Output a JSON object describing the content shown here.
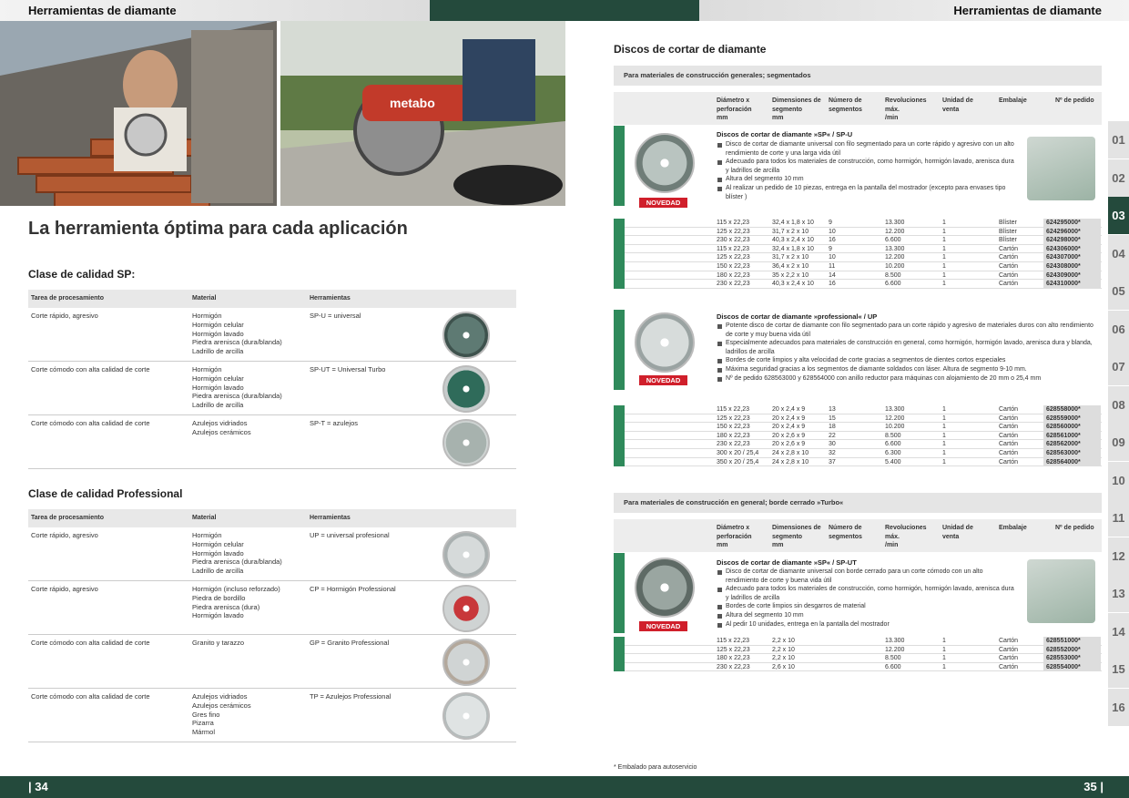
{
  "header": {
    "left_title": "Herramientas de diamante",
    "right_title": "Herramientas de diamante"
  },
  "left": {
    "headline": "La herramienta óptima para cada aplicación",
    "sp": {
      "title": "Clase de calidad SP:",
      "head": {
        "task": "Tarea de procesamiento",
        "material": "Material",
        "tool": "Herramientas"
      },
      "rows": [
        {
          "task": "Corte rápido, agresivo",
          "material": "Hormigón\nHormigón celular\nHormigón lavado\nPiedra arenisca (dura/blanda)\nLadrillo de arcilla",
          "tool": "SP-U = universal"
        },
        {
          "task": "Corte cómodo con alta calidad de corte",
          "material": "Hormigón\nHormigón celular\nHormigón lavado\nPiedra arenisca (dura/blanda)\nLadrillo de arcilla",
          "tool": "SP-UT = Universal Turbo"
        },
        {
          "task": "Corte cómodo con alta calidad de corte",
          "material": "Azulejos vidriados\nAzulejos cerámicos",
          "tool": "SP-T = azulejos"
        }
      ]
    },
    "pro": {
      "title": "Clase de calidad Professional",
      "head": {
        "task": "Tarea de procesamiento",
        "material": "Material",
        "tool": "Herramientas"
      },
      "rows": [
        {
          "task": "Corte rápido, agresivo",
          "material": "Hormigón\nHormigón celular\nHormigón lavado\nPiedra arenisca (dura/blanda)\nLadrillo de arcilla",
          "tool": "UP = universal profesional"
        },
        {
          "task": "Corte rápido, agresivo",
          "material": "Hormigón (incluso reforzado)\nPiedra de bordillo\nPiedra arenisca (dura)\nHormigón lavado",
          "tool": "CP = Hormigón Professional"
        },
        {
          "task": "Corte cómodo con alta calidad de corte",
          "material": "Granito y tarazzo",
          "tool": "GP = Granito Professional"
        },
        {
          "task": "Corte cómodo con alta calidad de corte",
          "material": "Azulejos vidriados\nAzulejos cerámicos\nGres fino\nPizarra\nMármol",
          "tool": "TP = Azulejos Professional"
        }
      ]
    }
  },
  "right": {
    "title": "Discos de cortar de diamante",
    "cols": {
      "dia": "Diámetro x\nperforación\nmm",
      "dim": "Dimensiones de\nsegmento\nmm",
      "num": "Número de\nsegmentos",
      "rev": "Revoluciones\nmáx.\n/min",
      "unit": "Unidad de\nventa",
      "pack": "Embalaje",
      "order": "Nº de pedido"
    },
    "sec1": "Para materiales de construcción generales; segmentados",
    "sec2": "Para materiales de construcción en general; borde cerrado »Turbo«",
    "badge": "NOVEDAD",
    "p1": {
      "title": "Discos de cortar de diamante »SP« / SP-U",
      "bullets": [
        "Disco de cortar de diamante universal con filo segmentado para un corte rápido y agresivo con un alto rendimiento de corte y una larga vida útil",
        "Adecuado para todos los materiales de construcción, como hormigón, hormigón lavado, arenisca dura y ladrillos de arcilla",
        "Altura del segmento 10 mm",
        "Al realizar un pedido de 10 piezas, entrega en la pantalla del mostrador (excepto para envases tipo blíster )"
      ],
      "rows": [
        [
          "115 x 22,23",
          "32,4 x 1,8 x 10",
          "9",
          "13.300",
          "1",
          "Blíster",
          "624295000*"
        ],
        [
          "125 x 22,23",
          "31,7 x 2 x 10",
          "10",
          "12.200",
          "1",
          "Blíster",
          "624296000*"
        ],
        [
          "230 x 22,23",
          "40,3 x 2,4 x 10",
          "16",
          "6.600",
          "1",
          "Blíster",
          "624298000*"
        ],
        [
          "115 x 22,23",
          "32,4 x 1,8 x 10",
          "9",
          "13.300",
          "1",
          "Cartón",
          "624306000*"
        ],
        [
          "125 x 22,23",
          "31,7 x 2 x 10",
          "10",
          "12.200",
          "1",
          "Cartón",
          "624307000*"
        ],
        [
          "150 x 22,23",
          "36,4 x 2 x 10",
          "11",
          "10.200",
          "1",
          "Cartón",
          "624308000*"
        ],
        [
          "180 x 22,23",
          "35 x 2,2 x 10",
          "14",
          "8.500",
          "1",
          "Cartón",
          "624309000*"
        ],
        [
          "230 x 22,23",
          "40,3 x 2,4 x 10",
          "16",
          "6.600",
          "1",
          "Cartón",
          "624310000*"
        ]
      ]
    },
    "p2": {
      "title": "Discos de cortar de diamante »professional« / UP",
      "bullets": [
        "Potente disco de cortar de diamante con filo segmentado para un corte rápido y agresivo de materiales duros con alto rendimiento de corte y muy buena vida útil",
        "Especialmente adecuados para materiales de construcción en general, como hormigón, hormigón lavado, arenisca dura y blanda, ladrillos de arcilla",
        "Bordes de corte limpios y alta velocidad de corte gracias a segmentos de dientes cortos especiales",
        "Máxima seguridad gracias a los segmentos de diamante soldados con láser. Altura de segmento 9-10 mm.",
        "Nº de pedido 628563000 y 628564000 con anillo reductor para máquinas con alojamiento de 20 mm o 25,4 mm"
      ],
      "rows": [
        [
          "115 x 22,23",
          "20 x 2,4 x 9",
          "13",
          "13.300",
          "1",
          "Cartón",
          "628558000*"
        ],
        [
          "125 x 22,23",
          "20 x 2,4 x 9",
          "15",
          "12.200",
          "1",
          "Cartón",
          "628559000*"
        ],
        [
          "150 x 22,23",
          "20 x 2,4 x 9",
          "18",
          "10.200",
          "1",
          "Cartón",
          "628560000*"
        ],
        [
          "180 x 22,23",
          "20 x 2,6 x 9",
          "22",
          "8.500",
          "1",
          "Cartón",
          "628561000*"
        ],
        [
          "230 x 22,23",
          "20 x 2,6 x 9",
          "30",
          "6.600",
          "1",
          "Cartón",
          "628562000*"
        ],
        [
          "300 x 20 / 25,4",
          "24 x 2,8 x 10",
          "32",
          "6.300",
          "1",
          "Cartón",
          "628563000*"
        ],
        [
          "350 x 20 / 25,4",
          "24 x 2,8 x 10",
          "37",
          "5.400",
          "1",
          "Cartón",
          "628564000*"
        ]
      ]
    },
    "p3": {
      "title": "Discos de cortar de diamante »SP« / SP-UT",
      "bullets": [
        "Disco de cortar de diamante universal con borde cerrado para un corte cómodo con un alto rendimiento de corte y buena vida útil",
        "Adecuado para todos los materiales de construcción, como hormigón, hormigón lavado, arenisca dura y ladrillos de arcilla",
        "Bordes de corte limpios sin desgarros de material",
        "Altura del segmento 10 mm",
        "Al pedir 10 unidades, entrega en la pantalla del mostrador"
      ],
      "rows": [
        [
          "115 x 22,23",
          "2,2 x 10",
          "",
          "13.300",
          "1",
          "Cartón",
          "628551000*"
        ],
        [
          "125 x 22,23",
          "2,2 x 10",
          "",
          "12.200",
          "1",
          "Cartón",
          "628552000*"
        ],
        [
          "180 x 22,23",
          "2,2 x 10",
          "",
          "8.500",
          "1",
          "Cartón",
          "628553000*"
        ],
        [
          "230 x 22,23",
          "2,6 x 10",
          "",
          "6.600",
          "1",
          "Cartón",
          "628554000*"
        ]
      ]
    }
  },
  "tabs": [
    "01",
    "02",
    "03",
    "04",
    "05",
    "06",
    "07",
    "08",
    "09",
    "10",
    "11",
    "12",
    "13",
    "14",
    "15",
    "16"
  ],
  "footnote": "* Embalado para autoservicio",
  "footer": {
    "left": "| 34",
    "right": "35 |"
  }
}
